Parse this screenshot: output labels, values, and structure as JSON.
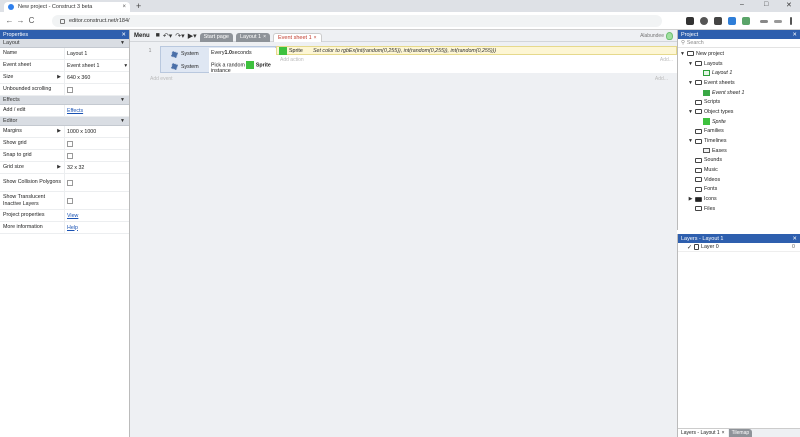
{
  "browser": {
    "tab_title": "New project - Construct 3 beta",
    "tab_close": "×",
    "new_tab": "+",
    "url": "editor.construct.net/r184/",
    "nav_back": "←",
    "nav_forward": "→",
    "nav_reload": "C",
    "window_controls": [
      "–",
      "□",
      "✕"
    ]
  },
  "editor": {
    "menu_label": "Menu",
    "tabs": [
      {
        "label": "Start page",
        "state": "inactive"
      },
      {
        "label": "Layout 1",
        "close": "×",
        "state": "inactive"
      },
      {
        "label": "Event sheet 1",
        "close": "×",
        "state": "active"
      }
    ],
    "username": "Alabundee"
  },
  "properties": {
    "title": "Properties",
    "close": "✕",
    "sections": {
      "layout": "Layout",
      "effects": "Effects",
      "editor": "Editor"
    },
    "rows": {
      "name_k": "Name",
      "name_v": "Layout 1",
      "eventsheet_k": "Event sheet",
      "eventsheet_v": "Event sheet 1",
      "eventsheet_arrow": "▾",
      "size_k": "Size",
      "size_v": "640 x 360",
      "unbounded_k": "Unbounded scrolling",
      "addedit_k": "Add / edit",
      "addedit_v": "Effects",
      "margins_k": "Margins",
      "margins_v": "1000 x 1000",
      "showgrid_k": "Show grid",
      "snapgrid_k": "Snap to grid",
      "gridsize_k": "Grid size",
      "gridsize_v": "32 x 32",
      "showcoll_k": "Show Collision Polygons",
      "showtrans_k": "Show Translucent Inactive Layers",
      "projprops_k": "Project properties",
      "projprops_v": "View",
      "moreinfo_k": "More information",
      "moreinfo_v": "Help"
    }
  },
  "event_sheet": {
    "event_number": "1",
    "conditions": [
      {
        "object": "System",
        "text_pre": "Every ",
        "text_bold": "1.0",
        "text_post": " seconds"
      },
      {
        "object": "System",
        "text_pre": "Pick a random ",
        "text_bold": "Sprite",
        "text_post": "instance"
      }
    ],
    "action": {
      "object": "Sprite",
      "text": "Set color to rgbEx(int(random(0,255)), int(random(0,255)), int(random(0,255)))"
    },
    "add_action": "Add action",
    "add_action_right": "Add...",
    "add_event": "Add event",
    "add_event_right": "Add..."
  },
  "project": {
    "title": "Project",
    "close": "✕",
    "search_placeholder": "Search",
    "tree": {
      "root": "New project",
      "layouts": "Layouts",
      "layout1": "Layout 1",
      "eventsheets": "Event sheets",
      "eventsheet1": "Event sheet 1",
      "scripts": "Scripts",
      "objecttypes": "Object types",
      "sprite": "Sprite",
      "families": "Families",
      "timelines": "Timelines",
      "eases": "Eases",
      "sounds": "Sounds",
      "music": "Music",
      "videos": "Videos",
      "fonts": "Fonts",
      "icons": "Icons",
      "files": "Files"
    }
  },
  "layers": {
    "title": "Layers - Layout 1",
    "close": "✕",
    "layer_name": "Layer 0",
    "layer_num": "0",
    "tab_layers": "Layers - Layout 1",
    "tab_layers_close": "×",
    "tab_tilemap": "Tilemap"
  },
  "colors": {
    "panel_title": "#2e5fae",
    "sprite_green": "#3ec13e",
    "active_tab_text": "#c0392b",
    "action_bg": "#fdf6d4"
  }
}
